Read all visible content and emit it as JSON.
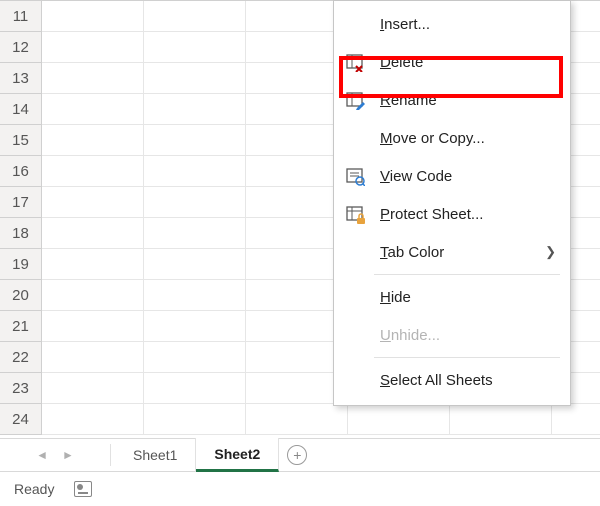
{
  "grid": {
    "rows": [
      11,
      12,
      13,
      14,
      15,
      16,
      17,
      18,
      19,
      20,
      21,
      22,
      23,
      24
    ]
  },
  "tabs": {
    "sheets": [
      {
        "name": "Sheet1",
        "active": false
      },
      {
        "name": "Sheet2",
        "active": true
      }
    ]
  },
  "statusbar": {
    "status": "Ready"
  },
  "context_menu": {
    "items": [
      {
        "key": "insert",
        "label": "Insert...",
        "underline": "I",
        "icon": "",
        "disabled": false,
        "submenu": false
      },
      {
        "key": "delete",
        "label": "Delete",
        "underline": "D",
        "icon": "delete",
        "disabled": false,
        "submenu": false
      },
      {
        "key": "rename",
        "label": "Rename",
        "underline": "R",
        "icon": "rename",
        "disabled": false,
        "submenu": false
      },
      {
        "key": "move",
        "label": "Move or Copy...",
        "underline": "M",
        "icon": "",
        "disabled": false,
        "submenu": false
      },
      {
        "key": "code",
        "label": "View Code",
        "underline": "V",
        "icon": "viewcode",
        "disabled": false,
        "submenu": false
      },
      {
        "key": "protect",
        "label": "Protect Sheet...",
        "underline": "P",
        "icon": "protect",
        "disabled": false,
        "submenu": false
      },
      {
        "key": "color",
        "label": "Tab Color",
        "underline": "T",
        "icon": "",
        "disabled": false,
        "submenu": true
      },
      {
        "key": "hide",
        "label": "Hide",
        "underline": "H",
        "icon": "",
        "disabled": false,
        "submenu": false
      },
      {
        "key": "unhide",
        "label": "Unhide...",
        "underline": "U",
        "icon": "",
        "disabled": true,
        "submenu": false
      },
      {
        "key": "selectall",
        "label": "Select All Sheets",
        "underline": "S",
        "icon": "",
        "disabled": false,
        "submenu": false
      }
    ]
  }
}
